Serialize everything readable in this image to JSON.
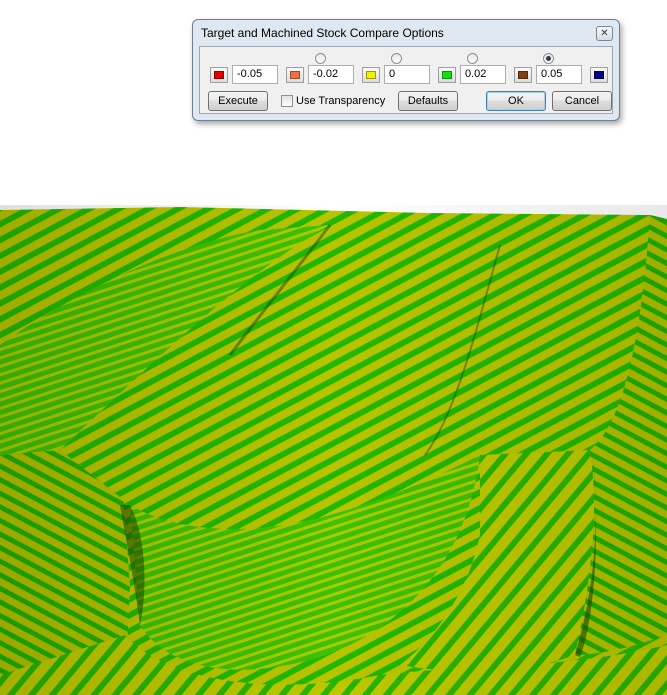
{
  "dialog": {
    "title": "Target and Machined Stock Compare Options",
    "close_glyph": "✕",
    "tolerances": [
      {
        "value": "-0.05",
        "swatch_color": "#e00000"
      },
      {
        "value": "-0.02",
        "swatch_color": "#f07040"
      },
      {
        "value": "0",
        "swatch_color": "#f0f000"
      },
      {
        "value": "0.02",
        "swatch_color": "#10e010"
      },
      {
        "value": "0.05",
        "swatch_color": "#804010"
      }
    ],
    "last_swatch_color": "#000080",
    "radios": [
      {
        "checked": false
      },
      {
        "checked": false
      },
      {
        "checked": false
      },
      {
        "checked": true
      }
    ],
    "execute_label": "Execute",
    "transparency_label": "Use Transparency",
    "transparency_checked": false,
    "defaults_label": "Defaults",
    "ok_label": "OK",
    "cancel_label": "Cancel"
  },
  "viewport": {
    "palette": {
      "yellow": "#b8c400",
      "green": "#22b800",
      "light_green": "#7fd400",
      "shadow": "#1c4a00"
    }
  }
}
